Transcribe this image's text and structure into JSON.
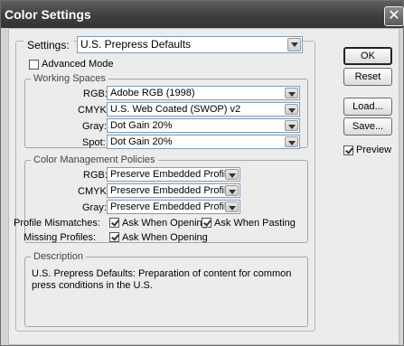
{
  "window": {
    "title": "Color Settings",
    "close_glyph": "✕"
  },
  "settings": {
    "label": "Settings:",
    "value": "U.S. Prepress Defaults"
  },
  "advanced_mode": {
    "label": "Advanced Mode",
    "checked": false
  },
  "working_spaces": {
    "legend": "Working Spaces",
    "rgb": {
      "label": "RGB:",
      "value": "Adobe RGB (1998)"
    },
    "cmyk": {
      "label": "CMYK:",
      "value": "U.S. Web Coated (SWOP) v2"
    },
    "gray": {
      "label": "Gray:",
      "value": "Dot Gain 20%"
    },
    "spot": {
      "label": "Spot:",
      "value": "Dot Gain 20%"
    }
  },
  "policies": {
    "legend": "Color Management Policies",
    "rgb": {
      "label": "RGB:",
      "value": "Preserve Embedded Profiles"
    },
    "cmyk": {
      "label": "CMYK:",
      "value": "Preserve Embedded Profiles"
    },
    "gray": {
      "label": "Gray:",
      "value": "Preserve Embedded Profiles"
    },
    "mismatches": {
      "label": "Profile Mismatches:",
      "ask_opening": {
        "label": "Ask When Opening",
        "checked": true
      },
      "ask_pasting": {
        "label": "Ask When Pasting",
        "checked": true
      }
    },
    "missing": {
      "label": "Missing Profiles:",
      "ask_opening": {
        "label": "Ask When Opening",
        "checked": true
      }
    }
  },
  "description": {
    "legend": "Description",
    "text": "U.S. Prepress Defaults:  Preparation of content for common press conditions in the U.S."
  },
  "buttons": {
    "ok": "OK",
    "reset": "Reset",
    "load": "Load...",
    "save": "Save..."
  },
  "preview": {
    "label": "Preview",
    "checked": true
  }
}
